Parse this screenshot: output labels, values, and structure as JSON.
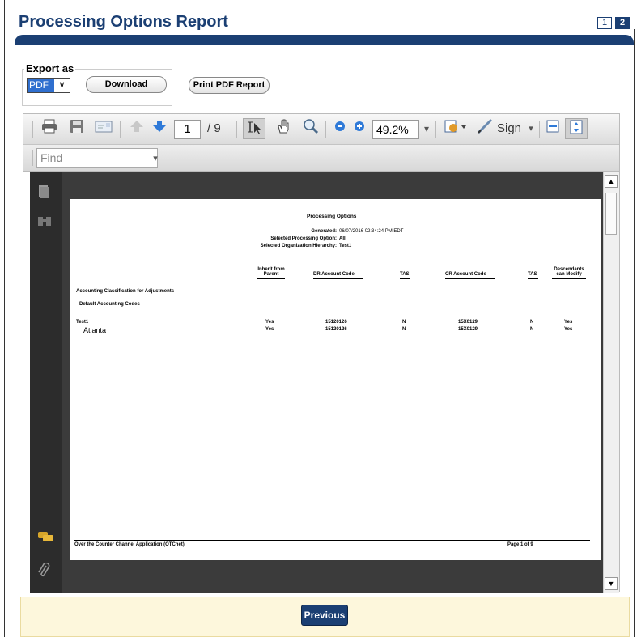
{
  "header": {
    "title": "Processing Options Report",
    "pages": [
      "1",
      "2"
    ],
    "active_page": "2"
  },
  "export": {
    "legend": "Export as",
    "format_value": "PDF",
    "format_arrow": "∨",
    "download_label": "Download",
    "print_label": "Print PDF Report"
  },
  "viewer": {
    "page_current": "1",
    "page_total": "/ 9",
    "zoom": "49.2%",
    "sign_label": "Sign",
    "find_placeholder": "Find"
  },
  "report": {
    "title": "Processing Options",
    "generated_label": "Generated:",
    "generated_value": "06/07/2016 02:34:24 PM EDT",
    "option_label": "Selected Processing Option:",
    "option_value": "All",
    "hierarchy_label": "Selected Organization Hierarchy:",
    "hierarchy_value": "Test1",
    "columns": {
      "inherit": [
        "Inherit from",
        "Parent"
      ],
      "dr_account": "DR Account Code",
      "tas1": "TAS",
      "cr_account": "CR Account Code",
      "tas2": "TAS",
      "descendants": [
        "Descendants",
        "can Modify"
      ]
    },
    "section_title": "Accounting Classification for Adjustments",
    "subsection_title": "Default Accounting Codes",
    "rows": [
      {
        "name": "Test1",
        "inherit": "Yes",
        "dr": "15120126",
        "tas1": "N",
        "cr": "15X0129",
        "tas2": "N",
        "descendants": "Yes"
      },
      {
        "name": "Atlanta",
        "inherit": "Yes",
        "dr": "15120126",
        "tas1": "N",
        "cr": "15X0129",
        "tas2": "N",
        "descendants": "Yes"
      }
    ],
    "footer_left": "Over the Counter Channel Application (OTCnet)",
    "footer_right": "Page 1 of 9"
  },
  "navigation": {
    "previous_label": "Previous"
  },
  "colors": {
    "brand_navy": "#1b3f73",
    "select_blue": "#2f6fcf",
    "panel_cream": "#fdf7dc"
  },
  "icons": [
    "print-icon",
    "save-icon",
    "email-icon",
    "arrow-up-icon",
    "arrow-down-icon",
    "select-cursor-icon",
    "hand-icon",
    "marquee-zoom-icon",
    "zoom-out-icon",
    "zoom-in-icon",
    "stamp-icon",
    "pen-icon",
    "fit-width-icon",
    "fit-page-icon",
    "page-thumbnails-icon",
    "binoculars-icon",
    "comments-icon",
    "attachment-icon"
  ]
}
